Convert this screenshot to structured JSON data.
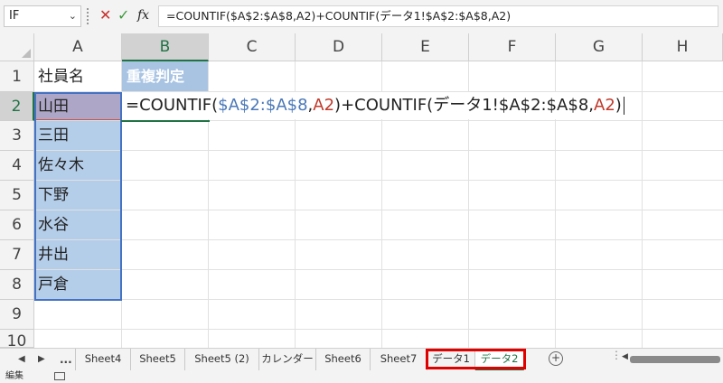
{
  "formula_bar": {
    "name_box": "IF",
    "cancel_icon": "close-icon",
    "enter_icon": "check-icon",
    "fx_label": "fx",
    "formula": "=COUNTIF($A$2:$A$8,A2)+COUNTIF(データ1!$A$2:$A$8,A2)"
  },
  "columns": [
    "A",
    "B",
    "C",
    "D",
    "E",
    "F",
    "G",
    "H"
  ],
  "rows": [
    "1",
    "2",
    "3",
    "4",
    "5",
    "6",
    "7",
    "8",
    "9",
    "10"
  ],
  "cells": {
    "A1": "社員名",
    "B1": "重複判定",
    "A_list": [
      "山田",
      "三田",
      "佐々木",
      "下野",
      "水谷",
      "井出",
      "戸倉"
    ]
  },
  "editing_formula": {
    "p1": "=COUNTIF(",
    "p2": "$A$2:$A$8",
    "p3": ",",
    "p4": "A2",
    "p5": ")+COUNTIF(データ1!$A$2:$A$8,",
    "p6": "A2",
    "p7": ")"
  },
  "sheet_tabs": {
    "ellipsis": "...",
    "tabs": [
      "Sheet4",
      "Sheet5",
      "Sheet5 (2)",
      "カレンダー",
      "Sheet6",
      "Sheet7",
      "データ1",
      "データ2"
    ],
    "active": "データ2",
    "add_label": "+"
  },
  "status_bar": {
    "mode": "編集"
  },
  "colors": {
    "accent": "#217346",
    "range_highlight": "#b4cde9",
    "annotation": "#e00000"
  }
}
